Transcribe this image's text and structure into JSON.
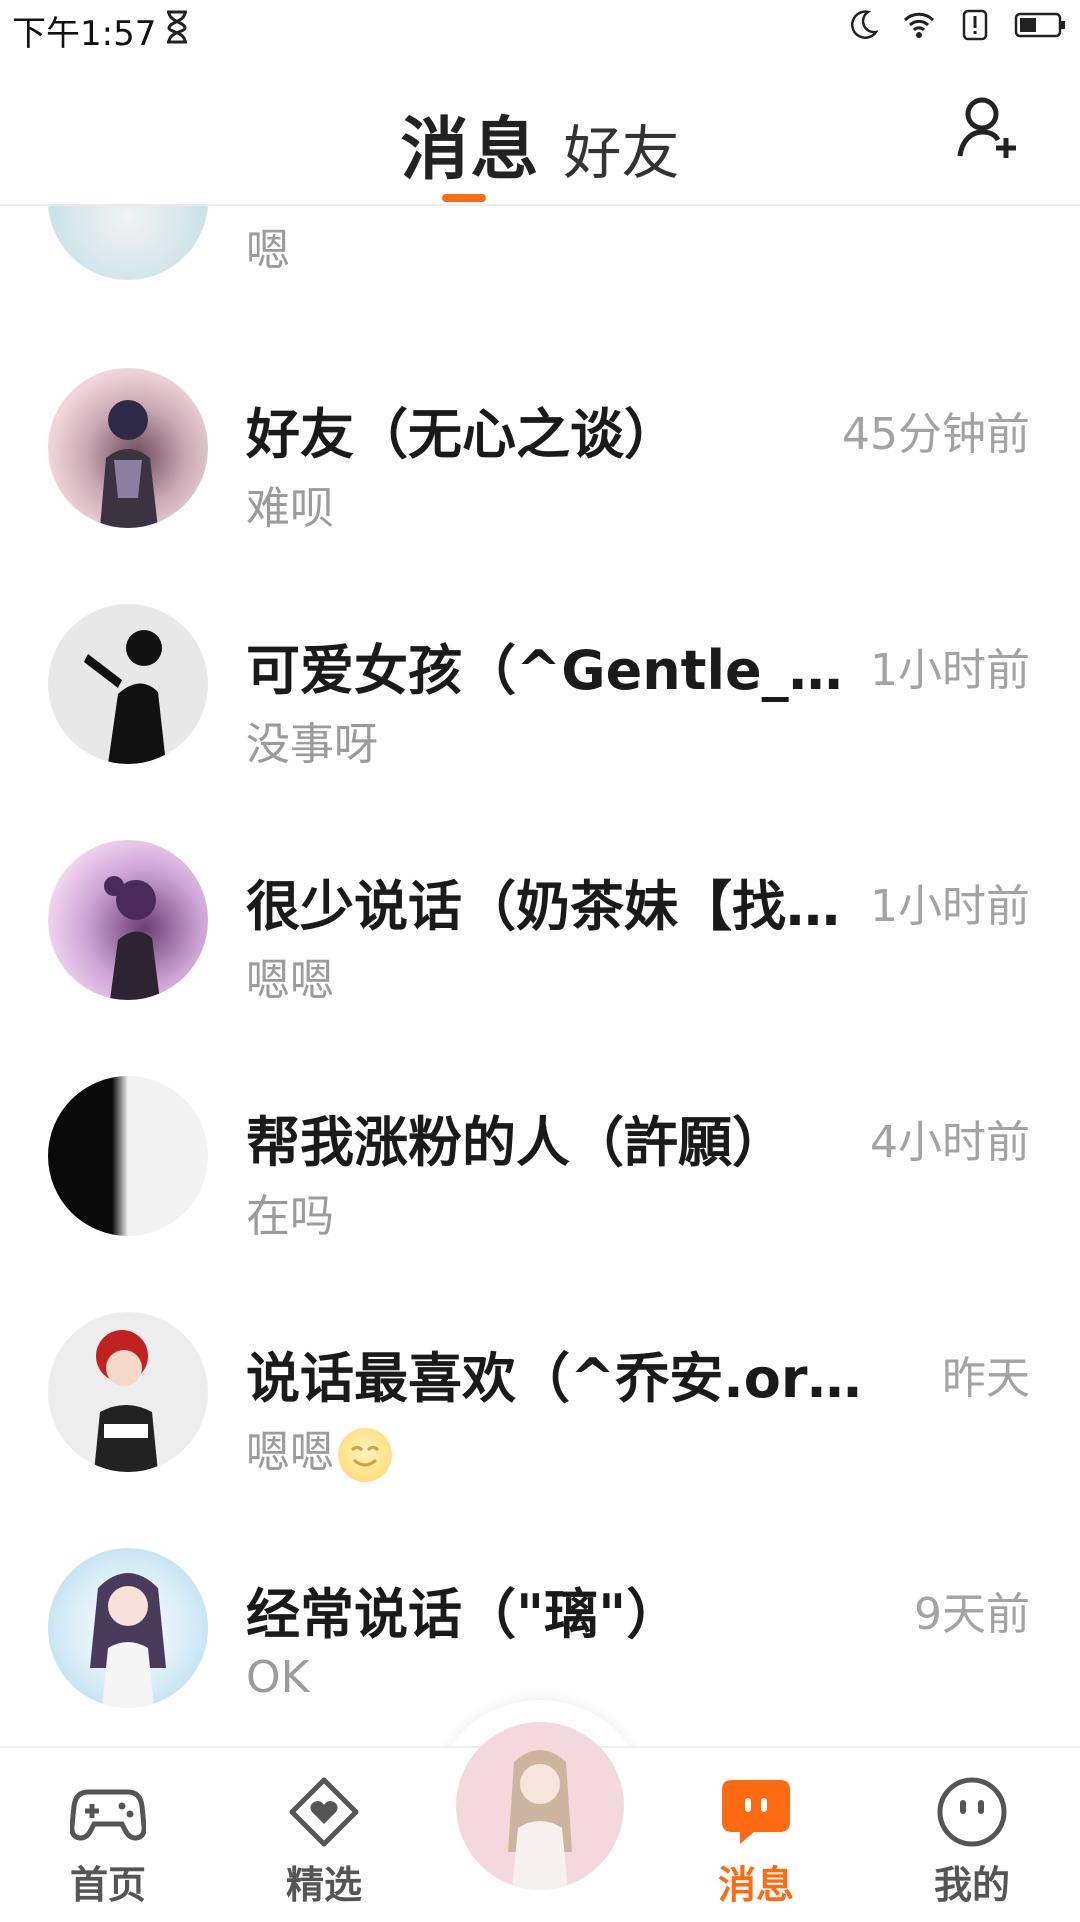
{
  "status_bar": {
    "time": "下午1:57",
    "icons": [
      "hourglass-icon",
      "moon-icon",
      "wifi-icon",
      "alert-icon",
      "battery-icon"
    ]
  },
  "header": {
    "tabs": [
      {
        "label": "消息",
        "active": true
      },
      {
        "label": "好友",
        "active": false
      }
    ],
    "accent_color": "#ff6a13",
    "action_icon": "add-user-icon"
  },
  "messages": [
    {
      "name": "",
      "time": "",
      "preview": "嗯"
    },
    {
      "name": "好友（无心之谈）",
      "time": "45分钟前",
      "preview": "难呗"
    },
    {
      "name": "可爱女孩（^Gentle_o桉…",
      "time": "1小时前",
      "preview": "没事呀"
    },
    {
      "name": "很少说话（奶茶妹【找…",
      "time": "1小时前",
      "preview": "嗯嗯"
    },
    {
      "name": "帮我涨粉的人（許願）",
      "time": "4小时前",
      "preview": "在吗"
    },
    {
      "name": "说话最喜欢（^乔安.orギ…",
      "time": "昨天",
      "preview": "嗯嗯",
      "preview_emoji": "smile-emoji"
    },
    {
      "name": "经常说话（\"璃\"）",
      "time": "9天前",
      "preview": "OK"
    }
  ],
  "bottom_nav": {
    "items": [
      {
        "label": "首页",
        "icon": "gamepad-icon",
        "active": false
      },
      {
        "label": "精选",
        "icon": "heart-badge-icon",
        "active": false
      },
      {
        "label": "",
        "icon": "avatar-center",
        "active": false
      },
      {
        "label": "消息",
        "icon": "chat-bubble-icon",
        "active": true
      },
      {
        "label": "我的",
        "icon": "smiley-face-icon",
        "active": false
      }
    ]
  }
}
